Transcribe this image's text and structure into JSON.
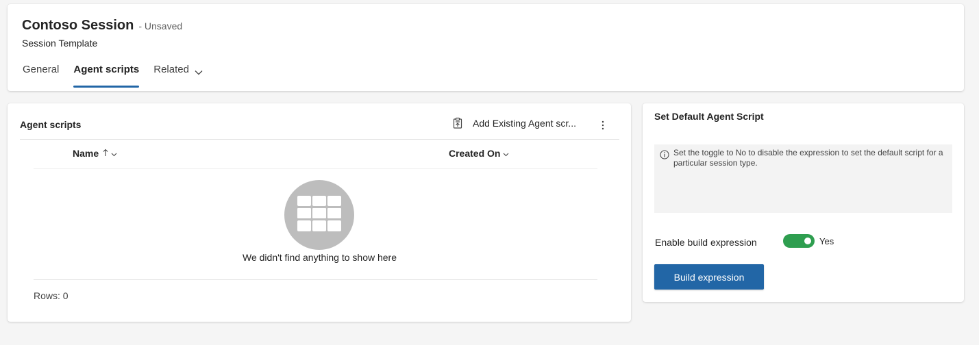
{
  "header": {
    "record_title": "Contoso Session",
    "save_status": "- Unsaved",
    "entity_name": "Session Template",
    "tabs": [
      {
        "label": "General",
        "active": false
      },
      {
        "label": "Agent scripts",
        "active": true
      },
      {
        "label": "Related",
        "active": false,
        "icon": "chevron-down-icon"
      }
    ]
  },
  "grid": {
    "title": "Agent scripts",
    "add_existing_label": "Add Existing Agent scr...",
    "add_existing_icon": "clipboard-add-icon",
    "more_icon": "more-vertical-icon",
    "columns": [
      {
        "label": "Name",
        "sort": "ascending",
        "icons": [
          "arrow-up-icon",
          "chevron-down-icon"
        ]
      },
      {
        "label": "Created On",
        "icons": [
          "chevron-down-icon"
        ]
      }
    ],
    "empty_icon": "table-grid-icon",
    "empty_message": "We didn't find anything to show here",
    "rows_label": "Rows: 0"
  },
  "default_script": {
    "title": "Set Default Agent Script",
    "info_icon": "info-icon",
    "info_text": "Set the toggle to No to disable the expression to set the default script for a particular session type.",
    "enable_label": "Enable build expression",
    "toggle_value": "Yes",
    "toggle_on": true,
    "build_button": "Build expression"
  },
  "colors": {
    "accent": "#2266a6",
    "toggle_on": "#2e9e4f",
    "empty_circle": "#bdbdbd",
    "page_bg": "#f5f5f5"
  }
}
